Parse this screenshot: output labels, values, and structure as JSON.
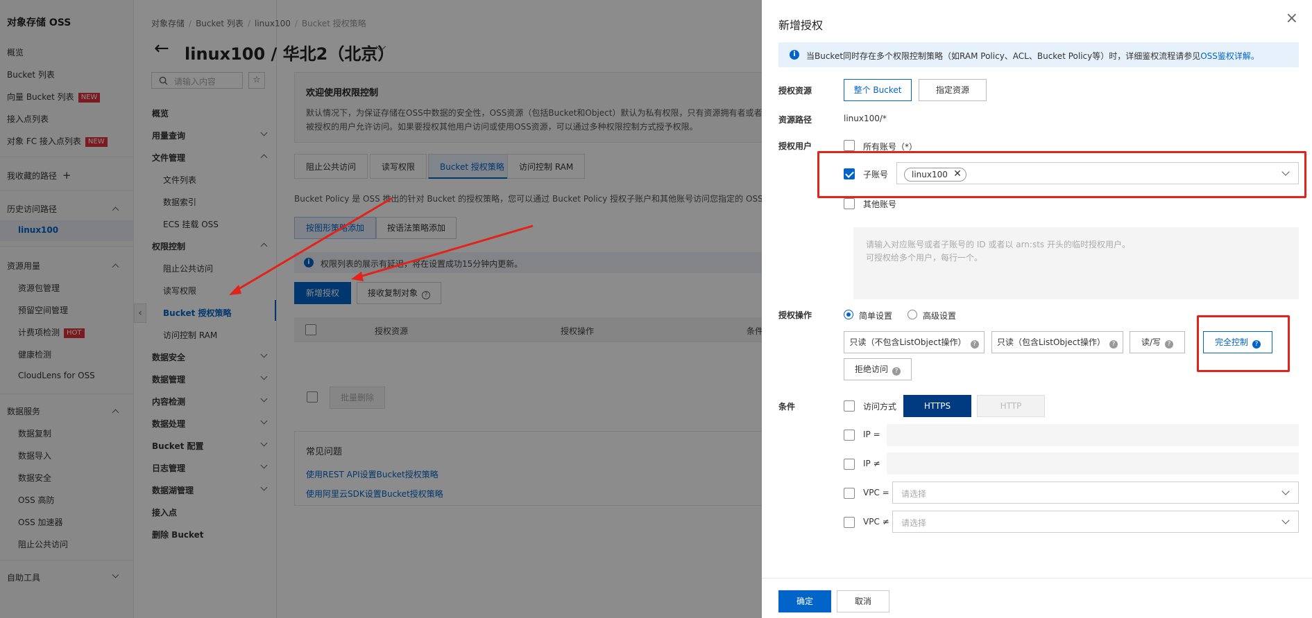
{
  "leftnav": {
    "title": "对象存储 OSS",
    "items": [
      "概览",
      "Bucket 列表",
      "向量 Bucket 列表",
      "接入点列表",
      "对象 FC 接入点列表"
    ],
    "badge_new": "NEW",
    "badge_hot": "HOT",
    "favorites": "我收藏的路径",
    "favorites_add": "+",
    "history": "历史访问路径",
    "history_item": "linux100",
    "resource_usage": "资源用量",
    "resource_items": [
      "资源包管理",
      "预留空间管理",
      "计费项检测",
      "健康检测",
      "CloudLens for OSS"
    ],
    "data_services": "数据服务",
    "data_service_items": [
      "数据复制",
      "数据导入",
      "数据安全",
      "OSS 高防",
      "OSS 加速器",
      "阻止公共访问"
    ],
    "self_tools": "自助工具"
  },
  "breadcrumb": [
    "对象存储",
    "Bucket 列表",
    "linux100",
    "Bucket 授权策略"
  ],
  "page_title": "linux100 / 华北2（北京）",
  "search": {
    "placeholder": "请输入内容"
  },
  "secnav": {
    "overview": "概览",
    "usage": "用量查询",
    "file_mgmt": "文件管理",
    "file_items": [
      "文件列表",
      "数据索引",
      "ECS 挂载 OSS"
    ],
    "perm": "权限控制",
    "perm_items": [
      "阻止公共访问",
      "读写权限",
      "Bucket 授权策略",
      "访问控制 RAM"
    ],
    "groups": [
      "数据安全",
      "数据管理",
      "内容检测",
      "数据处理",
      "Bucket 配置",
      "日志管理",
      "数据湖管理"
    ],
    "access_point": "接入点",
    "delete_bucket": "删除 Bucket"
  },
  "welcome": {
    "title": "欢迎使用权限控制",
    "text": "默认情况下，为保证存储在OSS中数据的安全性，OSS资源（包括Bucket和Object）默认为私有权限，只有资源拥有者或者被授权的用户允许访问。如果要授权其他用户访问或使用OSS资源，可以通过多种权限控制方式授予权限。"
  },
  "tabs": [
    "阻止公共访问",
    "读写权限",
    "Bucket 授权策略",
    "访问控制 RAM"
  ],
  "policy_desc": "Bucket Policy 是 OSS 推出的针对 Bucket 的授权策略，您可以通过 Bucket Policy 授权子账户和其他账号访问您指定的 OSS 资源。",
  "policy_buttons": [
    "按图形策略添加",
    "按语法策略添加"
  ],
  "info_text": "权限列表的展示有延迟，将在设置成功15分钟内更新。",
  "action_buttons": {
    "add": "新增授权",
    "receive": "接收复制对象"
  },
  "table_headers": [
    "授权资源",
    "授权操作",
    "条件"
  ],
  "batch_delete": "批量删除",
  "faq": {
    "title": "常见问题",
    "links": [
      "使用REST API设置Bucket授权策略",
      "使用阿里云SDK设置Bucket授权策略"
    ]
  },
  "drawer": {
    "title": "新增授权",
    "close": "×",
    "info_text": "当Bucket同时存在多个权限控制策略（如RAM Policy、ACL、Bucket Policy等）时，详细鉴权流程请参见",
    "info_link": "OSS鉴权详解。",
    "resource_label": "授权资源",
    "resource_options": [
      "整个 Bucket",
      "指定资源"
    ],
    "path_label": "资源路径",
    "path_value": "linux100/*",
    "user_label": "授权用户",
    "user_all": "所有账号（*）",
    "user_sub": "子账号",
    "user_sub_tag": "linux100",
    "user_other": "其他账号",
    "user_other_placeholder": "请输入对应账号或者子账号的 ID 或者以 arn:sts 开头的临时授权用户。\n可授权给多个用户，每行一个。",
    "op_label": "授权操作",
    "op_modes": [
      "简单设置",
      "高级设置"
    ],
    "op_options": [
      "只读（不包含ListObject操作）",
      "只读（包含ListObject操作）",
      "读/写",
      "完全控制",
      "拒绝访问"
    ],
    "cond_label": "条件",
    "cond_access": "访问方式",
    "cond_protocols": [
      "HTTPS",
      "HTTP"
    ],
    "cond_ip_eq": "IP =",
    "cond_ip_ne": "IP ≠",
    "cond_vpc_eq": "VPC =",
    "cond_vpc_ne": "VPC ≠",
    "select_placeholder": "请选择",
    "ok": "确定",
    "cancel": "取消"
  },
  "colors": {
    "accent": "#0064c8",
    "annotation": "#e2231a",
    "badge": "#e0303a"
  }
}
